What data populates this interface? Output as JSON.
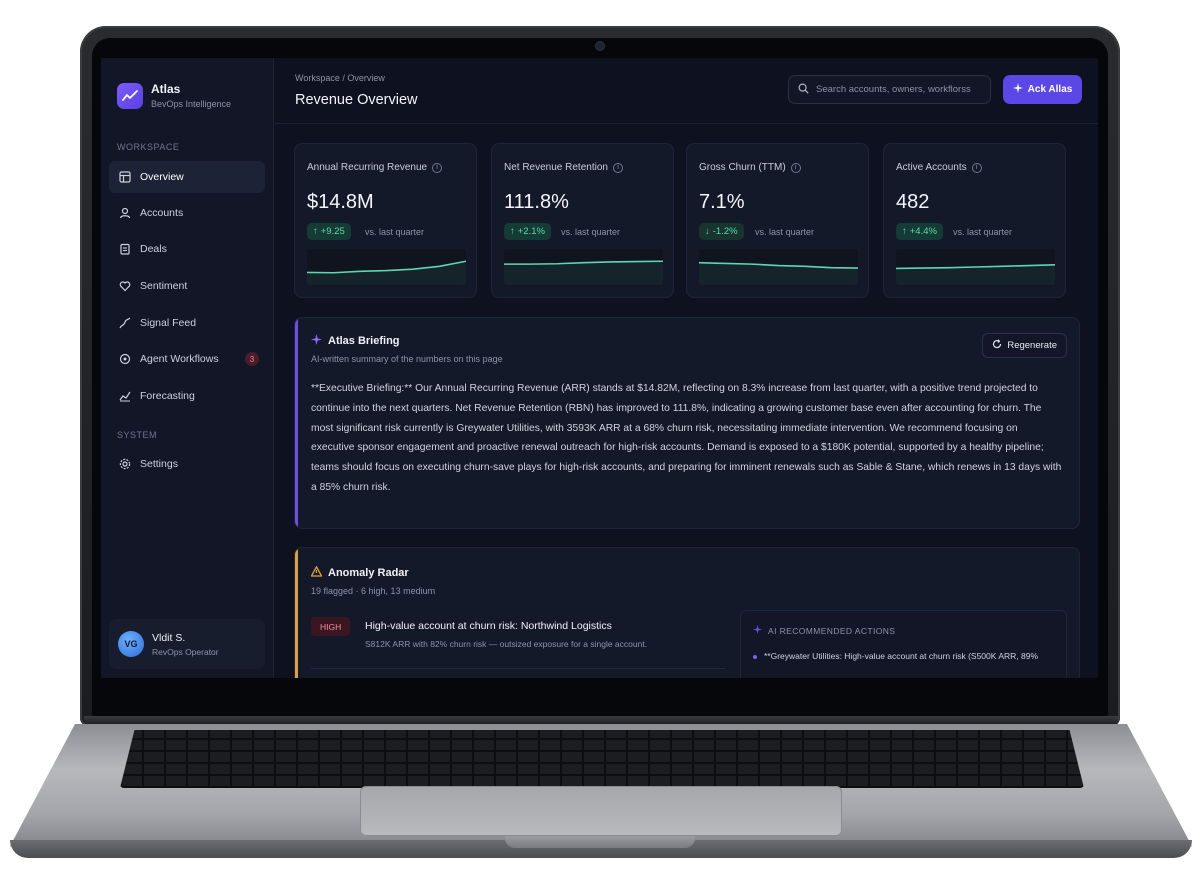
{
  "colors": {
    "accent": "#5b46e8",
    "positive": "#5ddbaa",
    "negative": "#ff8a9e",
    "briefing_accent": "#6b4fe6",
    "anomaly_accent": "#e0a13a",
    "sparkline": "#5ed6b0"
  },
  "brand": {
    "title": "Atlas",
    "subtitle": "BevOps Intelligence"
  },
  "sidebar": {
    "section_workspace": "WORKSPACE",
    "section_system": "SYSTEM",
    "items": [
      {
        "label": "Overview",
        "icon": "overview-icon"
      },
      {
        "label": "Accounts",
        "icon": "accounts-icon"
      },
      {
        "label": "Deals",
        "icon": "deals-icon"
      },
      {
        "label": "Sentiment",
        "icon": "sentiment-icon"
      },
      {
        "label": "Signal Feed",
        "icon": "signal-icon"
      },
      {
        "label": "Agent Workflows",
        "icon": "agent-icon",
        "badge": "3"
      },
      {
        "label": "Forecasting",
        "icon": "forecast-icon"
      }
    ],
    "settings_label": "Settings"
  },
  "user": {
    "initials": "VG",
    "name": "Vldit S.",
    "role": "RevOps Operator"
  },
  "header": {
    "breadcrumb": "Workspace / Overview",
    "title": "Revenue Overview",
    "search_placeholder": "Search accounts, owners, workflorss",
    "ask_label": "Ack Allas"
  },
  "kpis": [
    {
      "label": "Annual Recurring Revenue",
      "value": "$14.8M",
      "delta": "+9.25",
      "direction": "up",
      "compare": "vs. last quarter",
      "trend": [
        0.35,
        0.34,
        0.38,
        0.4,
        0.44,
        0.52,
        0.66
      ]
    },
    {
      "label": "Net Revenue Retention",
      "value": "111.8%",
      "delta": "+2.1%",
      "direction": "up",
      "compare": "vs. last quarter",
      "trend": [
        0.58,
        0.58,
        0.59,
        0.62,
        0.64,
        0.65,
        0.66
      ]
    },
    {
      "label": "Gross Churn (TTM)",
      "value": "7.1%",
      "delta": "-1.2%",
      "direction": "down",
      "compare": "vs. last quarter",
      "trend": [
        0.62,
        0.6,
        0.58,
        0.54,
        0.52,
        0.48,
        0.47
      ]
    },
    {
      "label": "Active Accounts",
      "value": "482",
      "delta": "+4.4%",
      "direction": "up",
      "compare": "vs. last quarter",
      "trend": [
        0.46,
        0.47,
        0.48,
        0.5,
        0.52,
        0.54,
        0.56
      ]
    }
  ],
  "briefing": {
    "title": "Atlas Briefing",
    "subtitle": "AI-written summary of the numbers on this page",
    "regenerate_label": "Regenerate",
    "text": "**Executive Briefing:** Our Annual Recurring Revenue (ARR) stands at $14.82M, reflecting on 8.3% increase from last quarter, with a positive trend projected to continue into the next quarters. Net Revenue Retention (RBN) has improved to 111.8%, indicating a growing customer base even after accounting for churn. The most significant risk currently is Greywater Utilities, with 3593K ARR at a 68% churn risk, necessitating immediate intervention. We recommend focusing on executive sponsor engagement and proactive renewal outreach for high-risk accounts. Demand is exposed to a $180K potential, supported by a healthy pipeline; teams should focus on executing churn-save plays for high-risk accounts, and preparing for imminent renewals such as Sable & Stane, which renews in 13 days with a 85% churn risk."
  },
  "anomaly": {
    "title": "Anomaly Radar",
    "subtitle": "19 flagged · 6 high, 13 medium",
    "items": [
      {
        "severity": "HIGH",
        "title": "High-value account at churn risk: Northwind Logistics",
        "desc": "S812K ARR with 82% churn risk — outsized exposure for a single account."
      }
    ],
    "ai_heading": "AI RECOMMENDED ACTIONS",
    "ai_actions": [
      "**Greywater Utilities: High-value account at churn risk (S500K ARR, 89%"
    ]
  }
}
